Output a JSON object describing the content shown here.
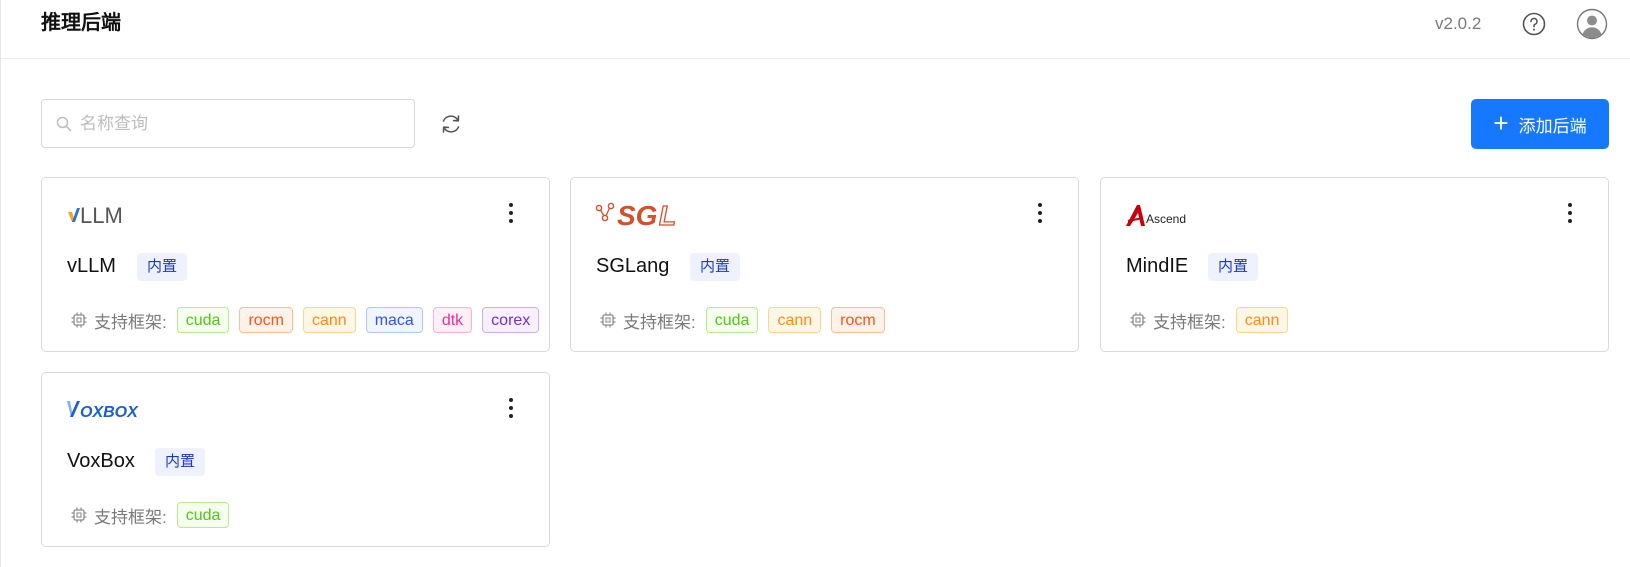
{
  "header": {
    "title": "推理后端",
    "version": "v2.0.2",
    "help_icon": "help-circle-icon",
    "avatar_icon": "user-avatar-icon"
  },
  "toolbar": {
    "search_placeholder": "名称查询",
    "search_value": "",
    "refresh_icon": "refresh-icon",
    "add_label": "添加后端",
    "add_icon": "plus-icon"
  },
  "framework_label": "支持框架:",
  "chip_colors": {
    "cuda": {
      "fg": "#52c41a",
      "bg": "#f6ffed",
      "bd": "#b7eb8f"
    },
    "rocm": {
      "fg": "#fa541c",
      "bg": "#fff2e8",
      "bd": "#ffbb96"
    },
    "cann": {
      "fg": "#fa8c16",
      "bg": "#fff7e6",
      "bd": "#ffd591"
    },
    "maca": {
      "fg": "#2f54eb",
      "bg": "#f0f5ff",
      "bd": "#adc6ff"
    },
    "dtk": {
      "fg": "#eb2f96",
      "bg": "#fff0f6",
      "bd": "#ffadd2"
    },
    "corex": {
      "fg": "#722ed1",
      "bg": "#f9f0ff",
      "bd": "#d3adf7"
    }
  },
  "cards": [
    {
      "logo_text": "vLLM",
      "name": "vLLM",
      "tag": "内置",
      "frameworks": [
        "cuda",
        "rocm",
        "cann",
        "maca",
        "dtk",
        "corex"
      ]
    },
    {
      "logo_text": "SGL",
      "name": "SGLang",
      "tag": "内置",
      "frameworks": [
        "cuda",
        "cann",
        "rocm"
      ]
    },
    {
      "logo_text": "Ascend",
      "name": "MindIE",
      "tag": "内置",
      "frameworks": [
        "cann"
      ]
    },
    {
      "logo_text": "VOXBOX",
      "name": "VoxBox",
      "tag": "内置",
      "frameworks": [
        "cuda"
      ]
    }
  ]
}
